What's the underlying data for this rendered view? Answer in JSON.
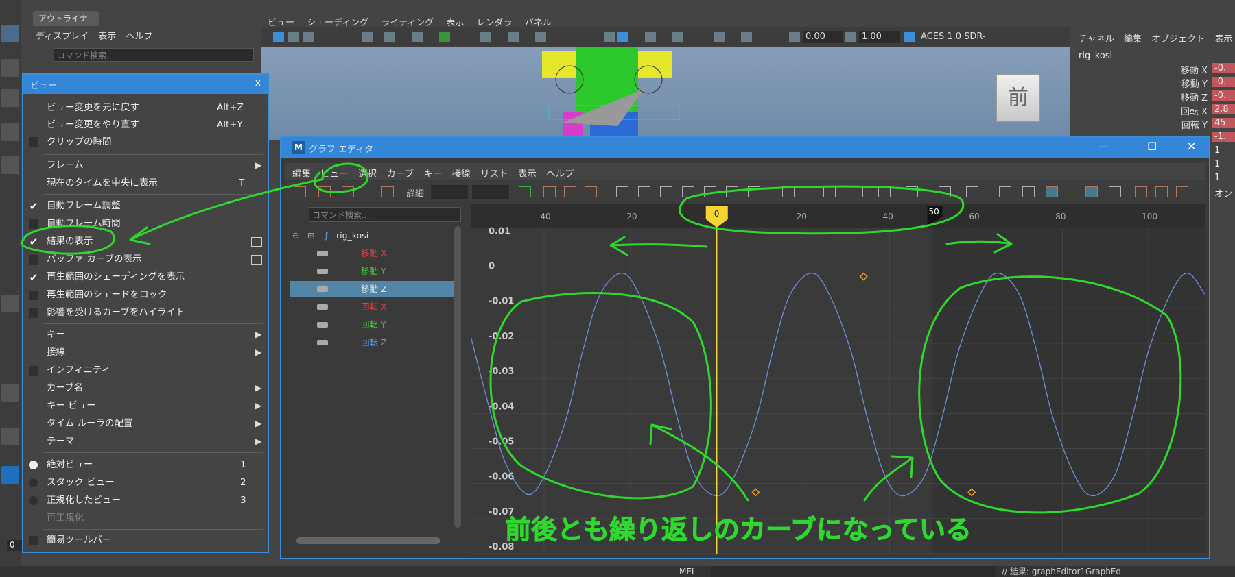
{
  "outliner": {
    "tab": "アウトライナ",
    "menu": [
      "ディスプレイ",
      "表示",
      "ヘルプ"
    ],
    "search_placeholder": "コマンド検索..."
  },
  "viewport": {
    "menu": [
      "ビュー",
      "シェーディング",
      "ライティング",
      "表示",
      "レンダラ",
      "パネル"
    ],
    "exposure": "0.00",
    "gamma": "1.00",
    "color_space": "ACES 1.0 SDR-",
    "view_cube_label": "前"
  },
  "channel_box": {
    "menu": [
      "チャネル",
      "編集",
      "オブジェクト",
      "表示"
    ],
    "object": "rig_kosi",
    "rows": [
      {
        "label": "移動 X",
        "value": "-0."
      },
      {
        "label": "移動 Y",
        "value": "-0."
      },
      {
        "label": "移動 Z",
        "value": "-0."
      },
      {
        "label": "回転 X",
        "value": "2.8"
      },
      {
        "label": "回転 Y",
        "value": "45"
      },
      {
        "label": "",
        "value": "-1."
      },
      {
        "label": "",
        "value": "1"
      },
      {
        "label": "",
        "value": "1"
      },
      {
        "label": "",
        "value": "1"
      },
      {
        "label": "",
        "value": "オン"
      }
    ]
  },
  "view_menu": {
    "title": "ビュー",
    "close": "x",
    "items": {
      "undo_view": {
        "label": "ビュー変更を元に戻す",
        "shortcut": "Alt+Z"
      },
      "redo_view": {
        "label": "ビュー変更をやり直す",
        "shortcut": "Alt+Y"
      },
      "clip_time": {
        "label": "クリップの時間"
      },
      "frame": {
        "label": "フレーム"
      },
      "center_current_time": {
        "label": "現在のタイムを中央に表示",
        "shortcut": "T"
      },
      "auto_frame": {
        "label": "自動フレーム調整"
      },
      "auto_frame_time": {
        "label": "自動フレーム時間"
      },
      "show_results": {
        "label": "結果の表示"
      },
      "show_buffer_curves": {
        "label": "バッファ カーブの表示"
      },
      "show_playback_shading": {
        "label": "再生範囲のシェーディングを表示"
      },
      "lock_playback_shade": {
        "label": "再生範囲のシェードをロック"
      },
      "highlight_affected": {
        "label": "影響を受けるカーブをハイライト"
      },
      "key": {
        "label": "キー"
      },
      "tangent": {
        "label": "接線"
      },
      "infinity": {
        "label": "インフィニティ"
      },
      "curve_name": {
        "label": "カーブ名"
      },
      "key_view": {
        "label": "キー ビュー"
      },
      "time_ruler": {
        "label": "タイム ルーラの配置"
      },
      "theme": {
        "label": "テーマ"
      },
      "absolute_view": {
        "label": "絶対ビュー",
        "shortcut": "1"
      },
      "stacked_view": {
        "label": "スタック ビュー",
        "shortcut": "2"
      },
      "normalized_view": {
        "label": "正規化したビュー",
        "shortcut": "3"
      },
      "renormalize": {
        "label": "再正規化"
      },
      "simple_toolbar": {
        "label": "簡易ツールバー"
      }
    }
  },
  "graph_editor": {
    "title": "グラフ エディタ",
    "logo": "M",
    "menu": [
      "編集",
      "ビュー",
      "選択",
      "カーブ",
      "キー",
      "接線",
      "リスト",
      "表示",
      "ヘルプ"
    ],
    "detail_label": "詳細",
    "search_placeholder": "コマンド検索...",
    "object": "rig_kosi",
    "channels": [
      {
        "label": "移動 X",
        "color": "#e84040"
      },
      {
        "label": "移動 Y",
        "color": "#3ccf3c"
      },
      {
        "label": "移動 Z",
        "color": "#dfe8f0"
      },
      {
        "label": "回転 X",
        "color": "#e84040"
      },
      {
        "label": "回転 Y",
        "color": "#3ccf3c"
      },
      {
        "label": "回転 Z",
        "color": "#5aa0ff"
      }
    ],
    "current_frame": "0",
    "end_frame_marker": "50"
  },
  "chart_data": {
    "type": "line",
    "x_ticks": [
      -40,
      -20,
      20,
      40,
      60,
      80,
      100
    ],
    "y_ticks": [
      "0.01",
      "0",
      "-0.01",
      "-0.02",
      "-0.03",
      "-0.04",
      "-0.05",
      "-0.06",
      "-0.07",
      "-0.08"
    ],
    "xlim": [
      -57,
      113
    ],
    "ylim": [
      -0.08,
      0.013
    ],
    "series": [
      {
        "color": "#6f8fd8",
        "x": [
          -57,
          -53,
          -49,
          -44,
          -40,
          -35,
          -31,
          -27,
          -22,
          -18,
          -13,
          -9,
          -5,
          0,
          4,
          9,
          13,
          17,
          22,
          26,
          31,
          35,
          39,
          43,
          48,
          52,
          56,
          61,
          65,
          70,
          74,
          78,
          83,
          87,
          92,
          96,
          100,
          105,
          109,
          113
        ],
        "y": [
          -0.018,
          -0.037,
          -0.054,
          -0.063,
          -0.058,
          -0.042,
          -0.022,
          -0.006,
          0.0,
          -0.006,
          -0.022,
          -0.042,
          -0.058,
          -0.0635,
          -0.058,
          -0.042,
          -0.022,
          -0.006,
          0.0,
          -0.006,
          -0.022,
          -0.042,
          -0.058,
          -0.0635,
          -0.058,
          -0.042,
          -0.022,
          -0.006,
          0.0,
          -0.006,
          -0.022,
          -0.042,
          -0.058,
          -0.0635,
          -0.058,
          -0.042,
          -0.022,
          -0.006,
          0.0,
          -0.006
        ]
      }
    ],
    "keys": [
      {
        "x": 9,
        "y": -0.0625
      },
      {
        "x": 34,
        "y": -0.001
      },
      {
        "x": 59,
        "y": -0.0625
      }
    ],
    "playback_shade_from": 50
  },
  "annotation": {
    "text": "前後とも繰り返しのカーブになっている",
    "color": "#2ed82e"
  },
  "bottom": {
    "mel_label": "MEL",
    "result": "// 結果: graphEditor1GraphEd",
    "frame": "0"
  }
}
